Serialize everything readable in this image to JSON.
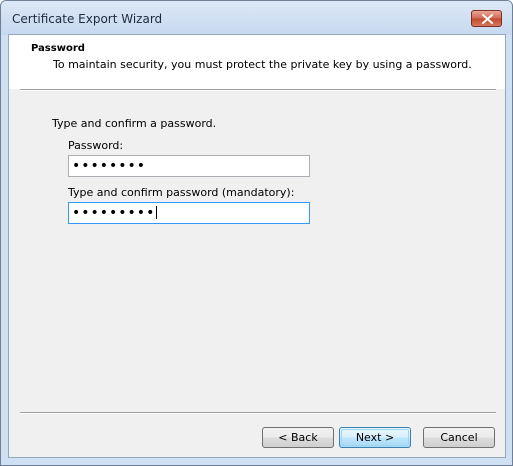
{
  "window": {
    "title": "Certificate Export Wizard"
  },
  "header": {
    "title": "Password",
    "description": "To maintain security, you must protect the private key by using a password."
  },
  "main": {
    "instruction": "Type and confirm a password.",
    "password_label": "Password:",
    "password_value": "••••••••",
    "confirm_label": "Type and confirm password (mandatory):",
    "confirm_value": "•••••••••"
  },
  "buttons": {
    "back": "< Back",
    "next": "Next >",
    "cancel": "Cancel"
  },
  "colors": {
    "title_bar": "#c6d9ef",
    "close_button": "#c14a30",
    "focus_border": "#3399ff",
    "dialog_background": "#f0f0f0"
  }
}
